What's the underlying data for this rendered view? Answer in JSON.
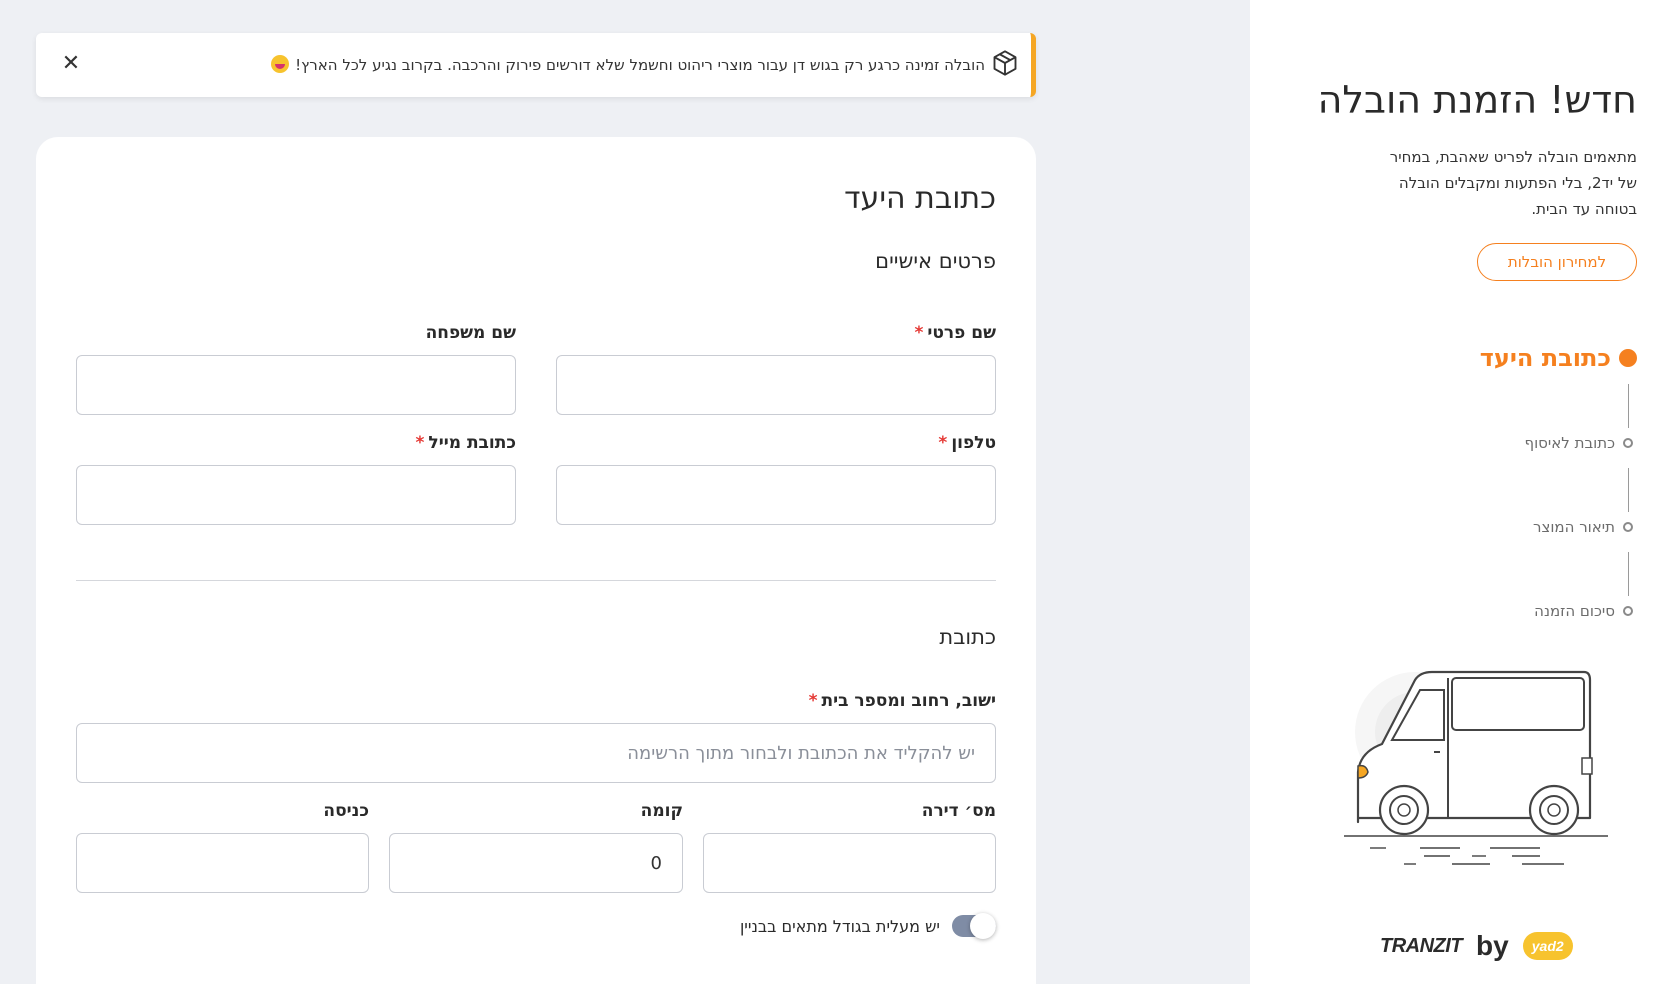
{
  "notice": {
    "text": "הובלה זמינה כרגע רק בגוש דן עבור מוצרי ריהוט וחשמל שלא דורשים פירוק והרכבה. בקרוב נגיע לכל הארץ!",
    "icon": "box-icon",
    "emoji": "smile-emoji-icon",
    "close_icon": "close-icon",
    "accent_color": "#f5a623"
  },
  "form": {
    "title": "כתובת היעד",
    "personal_section": "פרטים אישיים",
    "first_name_label": "שם פרטי",
    "last_name_label": "שם משפחה",
    "phone_label": "טלפון",
    "email_label": "כתובת מייל",
    "required_mark": "*",
    "address_section": "כתובת",
    "address_label": "ישוב, רחוב ומספר בית",
    "address_placeholder": "יש להקליד את הכתובת ולבחור מתוך הרשימה",
    "apartment_label": "מס׳ דירה",
    "floor_label": "קומה",
    "floor_value": "0",
    "entrance_label": "כניסה",
    "elevator_label": "יש מעלית בגודל מתאים בבניין",
    "elevator_on": true
  },
  "side": {
    "title": "חדש! הזמנת הובלה",
    "description": "מתאמים הובלה לפריט שאהבת, במחיר של יד2, בלי הפתעות ומקבלים הובלה בטוחה עד הבית.",
    "price_button": "למחירון הובלות",
    "accent_color": "#f5801f",
    "steps": [
      {
        "label": "כתובת היעד",
        "active": true
      },
      {
        "label": "כתובת לאיסוף",
        "active": false
      },
      {
        "label": "תיאור המוצר",
        "active": false
      },
      {
        "label": "סיכום הזמנה",
        "active": false
      }
    ],
    "brand": {
      "tranzit": "TRANZIT",
      "by": "by",
      "yad2": "yad2"
    }
  }
}
